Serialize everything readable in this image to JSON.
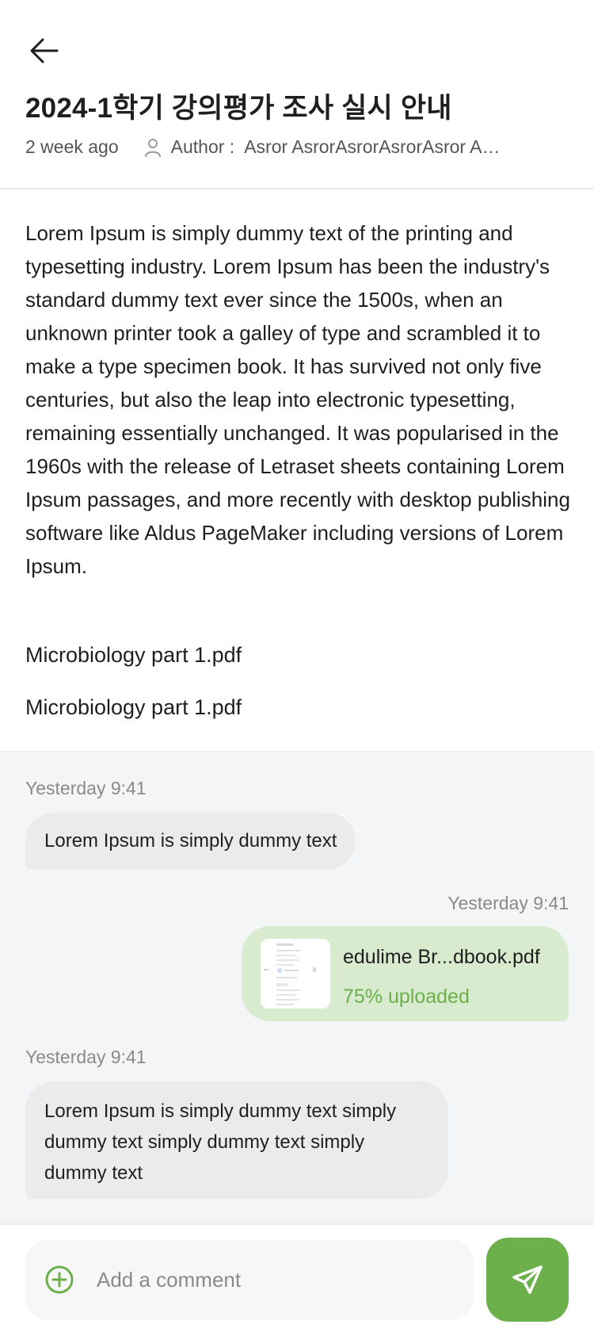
{
  "header": {
    "title": "2024-1학기 강의평가 조사 실시 안내",
    "time_ago": "2 week ago",
    "author_label": "Author :",
    "author_name": "Asror AsrorAsrorAsrorAsror Asror"
  },
  "post": {
    "body": "Lorem Ipsum is simply dummy text of the printing and typesetting industry. Lorem Ipsum has been the industry's standard dummy text ever since the 1500s, when an unknown printer took a galley of type and scrambled it to make a type specimen book. It has survived not only five centuries, but also the leap into electronic typesetting, remaining essentially unchanged. It was popularised in the 1960s with the release of Letraset sheets containing Lorem Ipsum passages, and more recently with desktop publishing software like Aldus PageMaker including versions of Lorem Ipsum.",
    "attachments": [
      "Microbiology part 1.pdf",
      "Microbiology part 1.pdf"
    ]
  },
  "chat": {
    "messages": [
      {
        "time": "Yesterday 9:41",
        "text": "Lorem Ipsum is simply dummy text",
        "direction": "incoming"
      },
      {
        "time": "Yesterday 9:41",
        "file_name": "edulime Br...dbook.pdf",
        "progress_text": "75% uploaded",
        "progress": 0.75,
        "direction": "outgoing"
      },
      {
        "time": "Yesterday 9:41",
        "text": "Lorem Ipsum is simply dummy text simply dummy text simply dummy text simply dummy text",
        "direction": "incoming"
      }
    ]
  },
  "composer": {
    "placeholder": "Add a comment"
  },
  "icons": {
    "back": "arrow-left-icon",
    "author": "person-icon",
    "add": "plus-circle-icon",
    "send": "send-icon",
    "file": "pdf-thumbnail"
  },
  "colors": {
    "accent": "#6bb04a",
    "outgoing_bubble": "#d8ebcf",
    "incoming_bubble": "#ebebeb",
    "chat_background": "#f4f5f7",
    "muted_text": "#8a8a8a"
  }
}
